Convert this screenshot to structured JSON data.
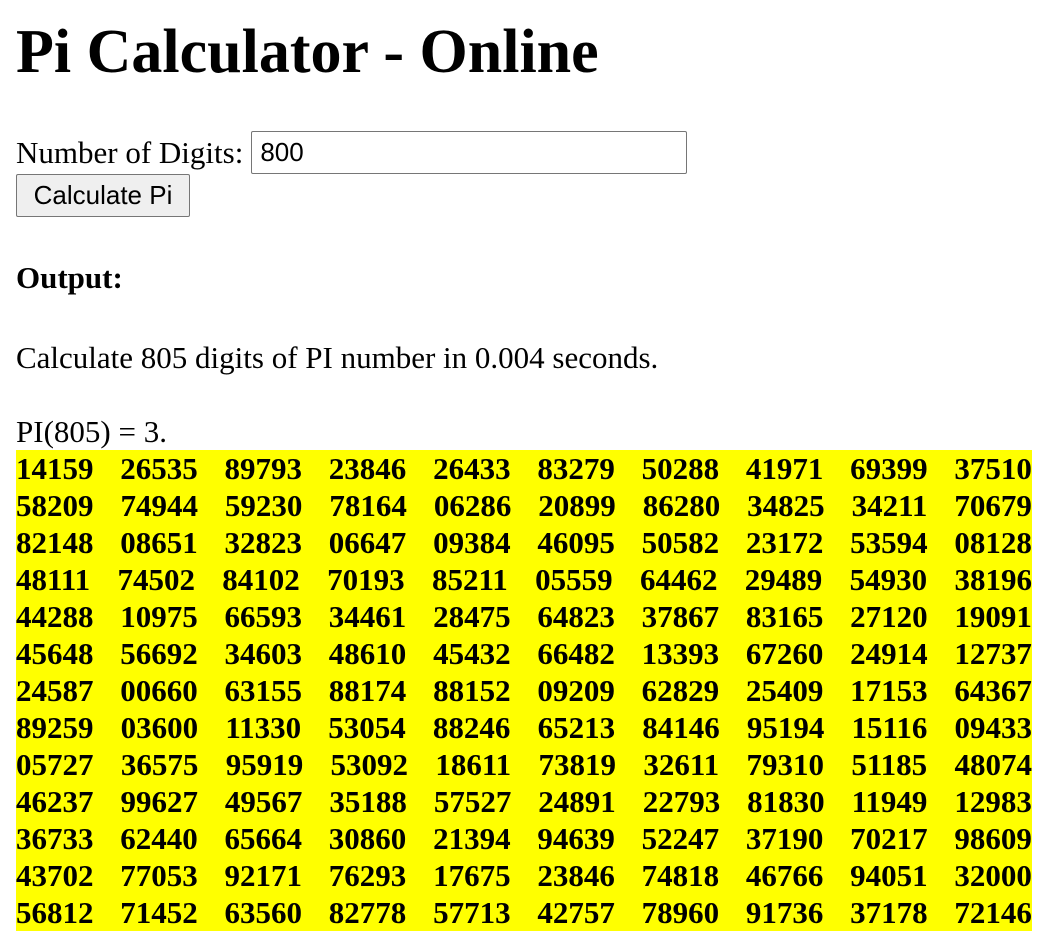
{
  "page": {
    "title": "Pi Calculator - Online"
  },
  "form": {
    "label": "Number of Digits:",
    "digits_value": "800",
    "button_label": "Calculate Pi"
  },
  "output": {
    "heading": "Output:",
    "summary": "Calculate 805 digits of PI number in 0.004 seconds.",
    "pi_prefix": "PI(805) = 3.",
    "rows": [
      [
        "14159",
        "26535",
        "89793",
        "23846",
        "26433",
        "83279",
        "50288",
        "41971",
        "69399",
        "37510"
      ],
      [
        "58209",
        "74944",
        "59230",
        "78164",
        "06286",
        "20899",
        "86280",
        "34825",
        "34211",
        "70679"
      ],
      [
        "82148",
        "08651",
        "32823",
        "06647",
        "09384",
        "46095",
        "50582",
        "23172",
        "53594",
        "08128"
      ],
      [
        "48111",
        "74502",
        "84102",
        "70193",
        "85211",
        "05559",
        "64462",
        "29489",
        "54930",
        "38196"
      ],
      [
        "44288",
        "10975",
        "66593",
        "34461",
        "28475",
        "64823",
        "37867",
        "83165",
        "27120",
        "19091"
      ],
      [
        "45648",
        "56692",
        "34603",
        "48610",
        "45432",
        "66482",
        "13393",
        "67260",
        "24914",
        "12737"
      ],
      [
        "24587",
        "00660",
        "63155",
        "88174",
        "88152",
        "09209",
        "62829",
        "25409",
        "17153",
        "64367"
      ],
      [
        "89259",
        "03600",
        "11330",
        "53054",
        "88246",
        "65213",
        "84146",
        "95194",
        "15116",
        "09433"
      ],
      [
        "05727",
        "36575",
        "95919",
        "53092",
        "18611",
        "73819",
        "32611",
        "79310",
        "51185",
        "48074"
      ],
      [
        "46237",
        "99627",
        "49567",
        "35188",
        "57527",
        "24891",
        "22793",
        "81830",
        "11949",
        "12983"
      ],
      [
        "36733",
        "62440",
        "65664",
        "30860",
        "21394",
        "94639",
        "52247",
        "37190",
        "70217",
        "98609"
      ],
      [
        "43702",
        "77053",
        "92171",
        "76293",
        "17675",
        "23846",
        "74818",
        "46766",
        "94051",
        "32000"
      ],
      [
        "56812",
        "71452",
        "63560",
        "82778",
        "57713",
        "42757",
        "78960",
        "91736",
        "37178",
        "72146"
      ]
    ]
  },
  "colors": {
    "highlight": "#ffff00"
  }
}
